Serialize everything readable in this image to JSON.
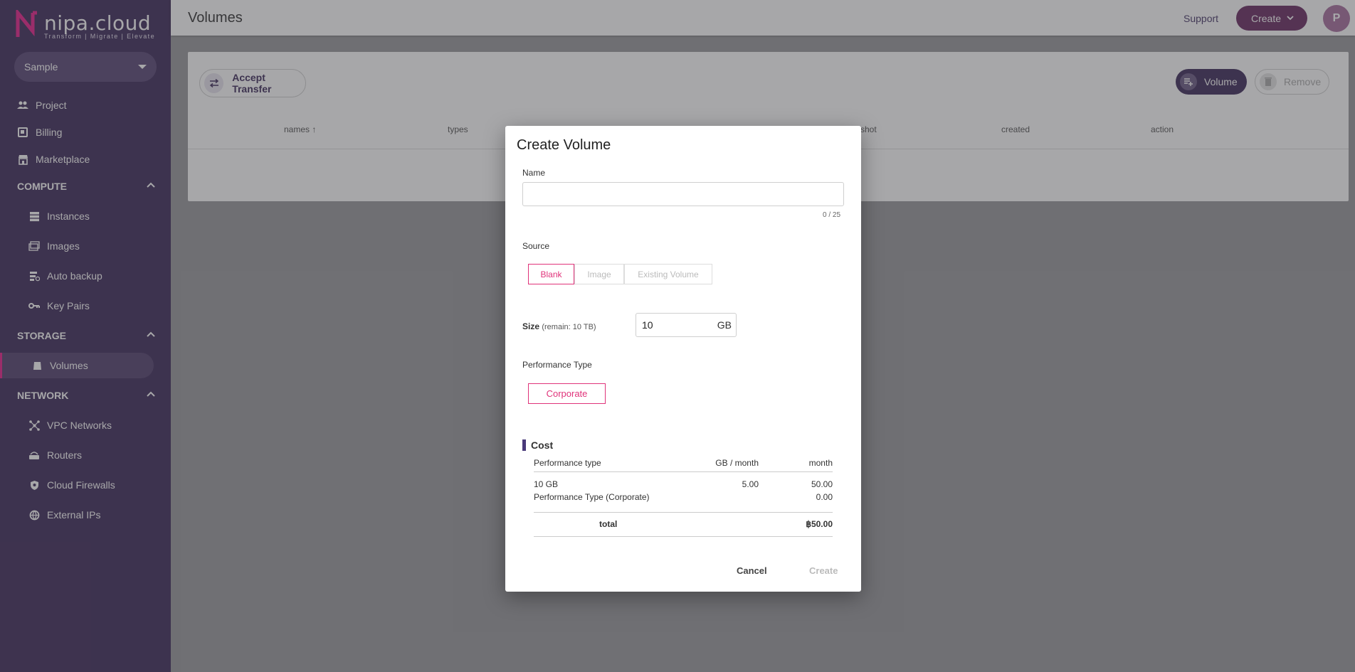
{
  "brand": {
    "name": "nipa.cloud",
    "tagline": "Transform  |  Migrate  |  Elevate"
  },
  "project_selector": {
    "value": "Sample"
  },
  "sidebar": {
    "top_items": [
      {
        "label": "Project",
        "icon": "people-icon"
      },
      {
        "label": "Billing",
        "icon": "billing-icon"
      },
      {
        "label": "Marketplace",
        "icon": "store-icon"
      }
    ],
    "sections": [
      {
        "title": "COMPUTE",
        "items": [
          "Instances",
          "Images",
          "Auto backup",
          "Key Pairs"
        ]
      },
      {
        "title": "STORAGE",
        "items": [
          "Volumes"
        ]
      },
      {
        "title": "NETWORK",
        "items": [
          "VPC Networks",
          "Routers",
          "Cloud Firewalls",
          "External IPs"
        ]
      }
    ],
    "active_item": "Volumes"
  },
  "header": {
    "title": "Volumes",
    "support": "Support",
    "create": "Create",
    "avatar_initial": "P"
  },
  "toolbar": {
    "accept_transfer": "Accept Transfer",
    "volume": "Volume",
    "remove": "Remove"
  },
  "table": {
    "columns": [
      "names",
      "types",
      "shot",
      "created",
      "action"
    ]
  },
  "modal": {
    "title": "Create Volume",
    "name_label": "Name",
    "name_value": "",
    "name_counter": "0 / 25",
    "source_label": "Source",
    "source_options": [
      "Blank",
      "Image",
      "Existing Volume"
    ],
    "source_selected": "Blank",
    "size_label": "Size",
    "size_remain": "(remain: 10 TB)",
    "size_value": "10",
    "size_unit": "GB",
    "performance_label": "Performance Type",
    "performance_option": "Corporate",
    "cost": {
      "title": "Cost",
      "headers": [
        "Performance type",
        "GB / month",
        "month"
      ],
      "rows": [
        {
          "item": "10 GB",
          "per_gb": "5.00",
          "month": "50.00"
        },
        {
          "item": "Performance Type (Corporate)",
          "per_gb": "",
          "month": "0.00"
        }
      ],
      "total_label": "total",
      "total_value": "฿50.00"
    },
    "cancel": "Cancel",
    "create": "Create"
  },
  "colors": {
    "sidebar_bg": "#3f2c5b",
    "accent_pink": "#e0337a",
    "create_btn": "#6a2c63",
    "avatar": "#a8709f"
  }
}
